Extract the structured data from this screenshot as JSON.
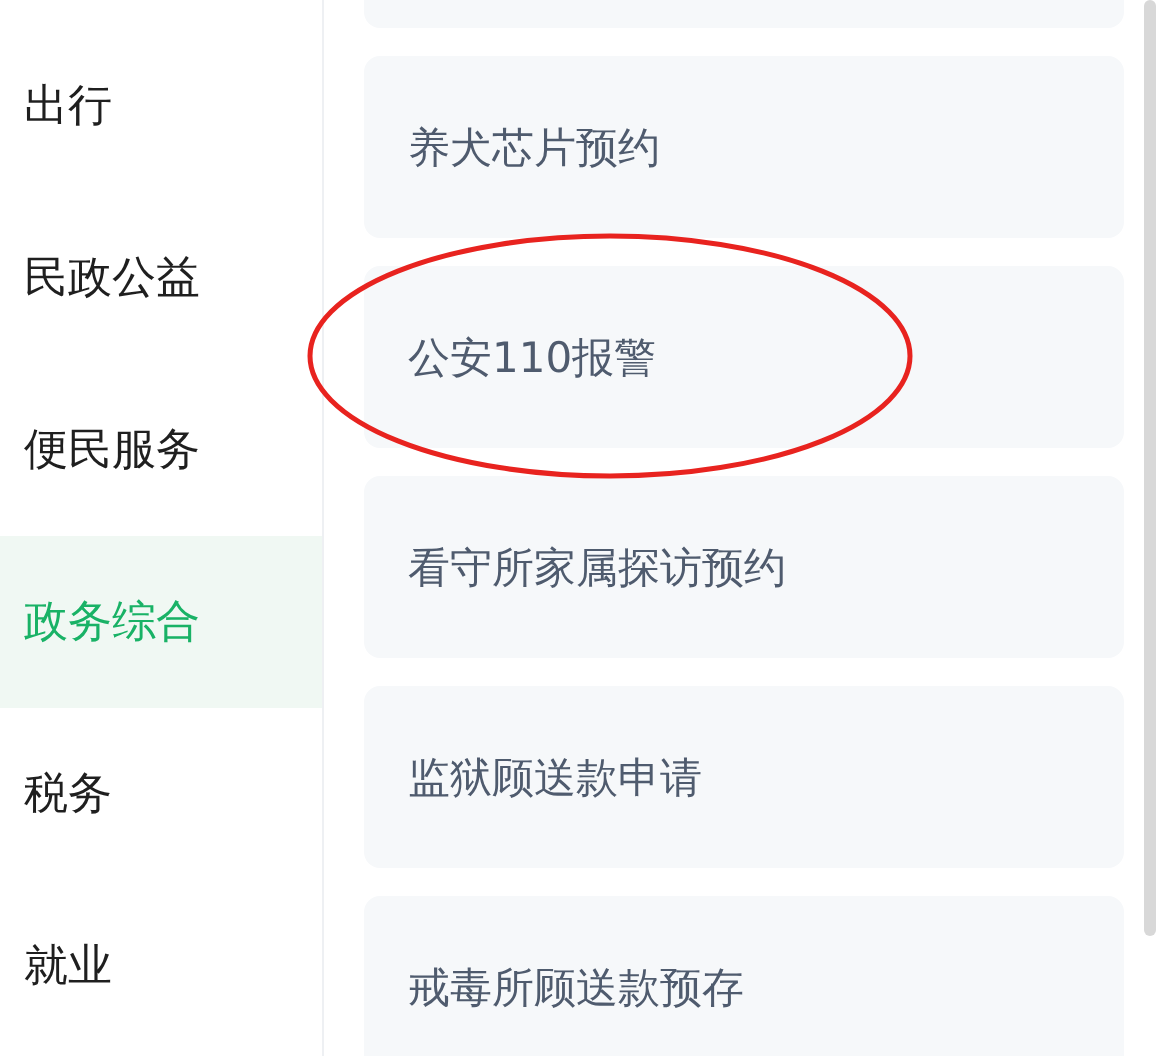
{
  "sidebar": {
    "items": [
      {
        "label": "出行",
        "selected": false
      },
      {
        "label": "民政公益",
        "selected": false
      },
      {
        "label": "便民服务",
        "selected": false
      },
      {
        "label": "政务综合",
        "selected": true
      },
      {
        "label": "税务",
        "selected": false
      },
      {
        "label": "就业",
        "selected": false
      }
    ]
  },
  "services": [
    {
      "label": "养犬芯片预约",
      "circled": false
    },
    {
      "label": "公安110报警",
      "circled": true
    },
    {
      "label": "看守所家属探访预约",
      "circled": false
    },
    {
      "label": "监狱顾送款申请",
      "circled": false
    },
    {
      "label": "戒毒所顾送款预存",
      "circled": false
    }
  ]
}
